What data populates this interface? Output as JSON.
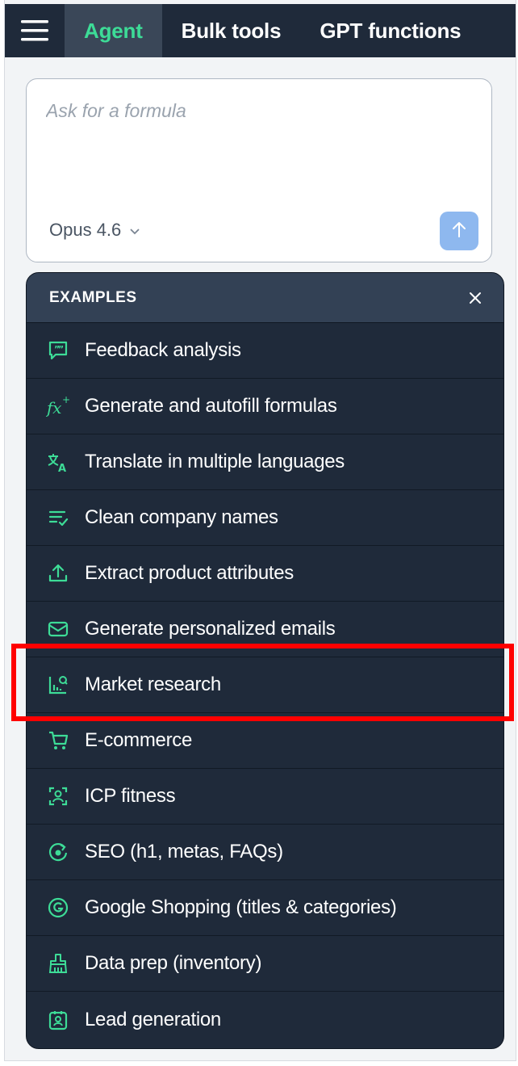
{
  "nav": {
    "menu_icon": "hamburger-menu-icon",
    "tabs": [
      {
        "label": "Agent",
        "active": true
      },
      {
        "label": "Bulk tools",
        "active": false
      },
      {
        "label": "GPT functions",
        "active": false
      }
    ]
  },
  "composer": {
    "placeholder": "Ask for a formula",
    "model": "Opus 4.6",
    "model_icon": "chevron-down-icon",
    "send_icon": "arrow-up-icon"
  },
  "examples": {
    "title": "EXAMPLES",
    "close_icon": "close-icon",
    "items": [
      {
        "label": "Feedback analysis",
        "icon": "quote-bubble-icon"
      },
      {
        "label": "Generate and autofill formulas",
        "icon": "function-fx-icon"
      },
      {
        "label": "Translate in multiple languages",
        "icon": "translate-icon"
      },
      {
        "label": "Clean company names",
        "icon": "list-clean-icon"
      },
      {
        "label": "Extract product attributes",
        "icon": "upload-extract-icon"
      },
      {
        "label": "Generate personalized emails",
        "icon": "mail-icon"
      },
      {
        "label": "Market research",
        "icon": "bar-chart-search-icon",
        "highlighted": true
      },
      {
        "label": "E-commerce",
        "icon": "shopping-cart-icon"
      },
      {
        "label": "ICP fitness",
        "icon": "user-target-icon"
      },
      {
        "label": "SEO (h1, metas, FAQs)",
        "icon": "refresh-target-icon"
      },
      {
        "label": "Google Shopping (titles & categories)",
        "icon": "google-g-icon"
      },
      {
        "label": "Data prep (inventory)",
        "icon": "brush-icon"
      },
      {
        "label": "Lead generation",
        "icon": "contact-badge-icon"
      }
    ]
  },
  "colors": {
    "nav_bg": "#1f2a3a",
    "active_tab_text": "#3ddc97",
    "panel_bg": "#1f2a3a",
    "send_button": "#8eb8ef",
    "highlight": "#ff0000"
  }
}
